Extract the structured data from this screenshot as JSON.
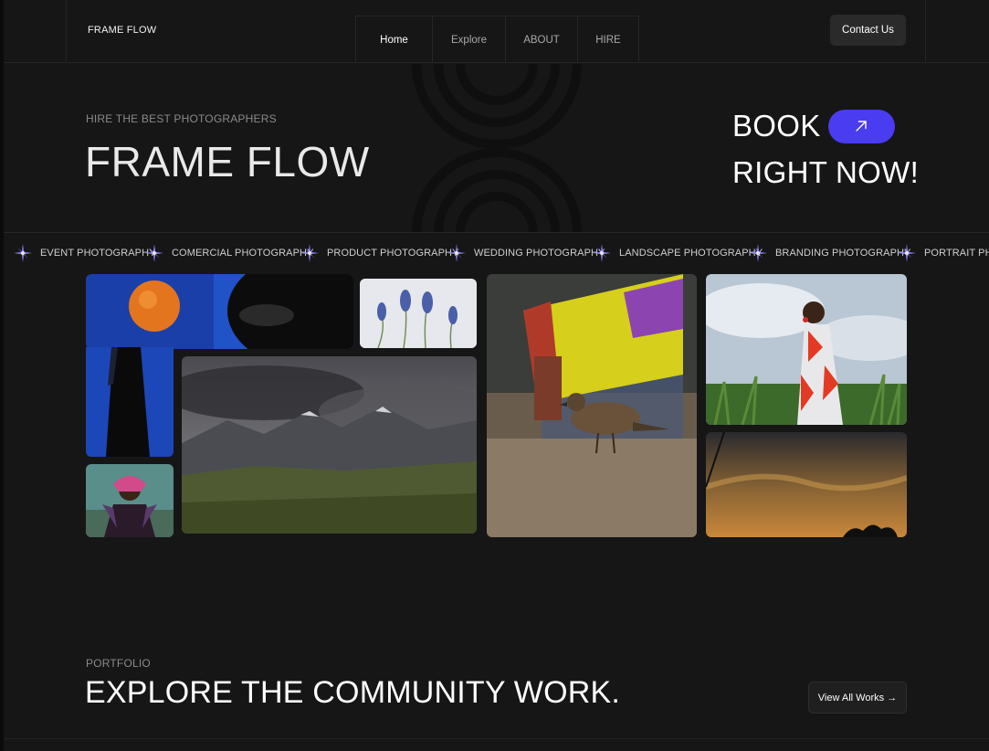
{
  "header": {
    "logo": "FRAME FLOW",
    "nav": [
      "Home",
      "Explore",
      "ABOUT",
      "HIRE"
    ],
    "active_nav": "Home",
    "contact_label": "Contact Us"
  },
  "hero": {
    "subtitle": "HIRE THE BEST PHOTOGRAPHERS",
    "title": "FRAME FLOW",
    "book_line1": "BOOK",
    "book_line2": "RIGHT NOW!",
    "book_button_icon": "arrow-up-right-icon"
  },
  "marquee": {
    "icon": "sparkle-star-icon",
    "items": [
      "EVENT PHOTOGRAPHY",
      "COMERCIAL PHOTOGRAPHY",
      "PRODUCT PHOTOGRAPHY",
      "WEDDING PHOTOGRAPHY",
      "LANDSCAPE PHOTOGRAPHY",
      "BRANDING PHOTOGRAPHY",
      "PORTRAIT PHOTOGRAPHY"
    ]
  },
  "gallery": {
    "photos": [
      "orange-portrait-photo",
      "hyacinth-flower-photo",
      "mountain-landscape-photo",
      "sparrow-photo",
      "woman-field-portrait-photo",
      "sunset-sky-photo",
      "headscarf-portrait-photo"
    ]
  },
  "portfolio": {
    "subtitle": "PORTFOLIO",
    "title": "EXPLORE THE COMMUNITY WORK.",
    "view_all_label": "View All Works →"
  },
  "colors": {
    "background": "#161616",
    "accent": "#4a3cf0",
    "star": "#8b7df5"
  }
}
